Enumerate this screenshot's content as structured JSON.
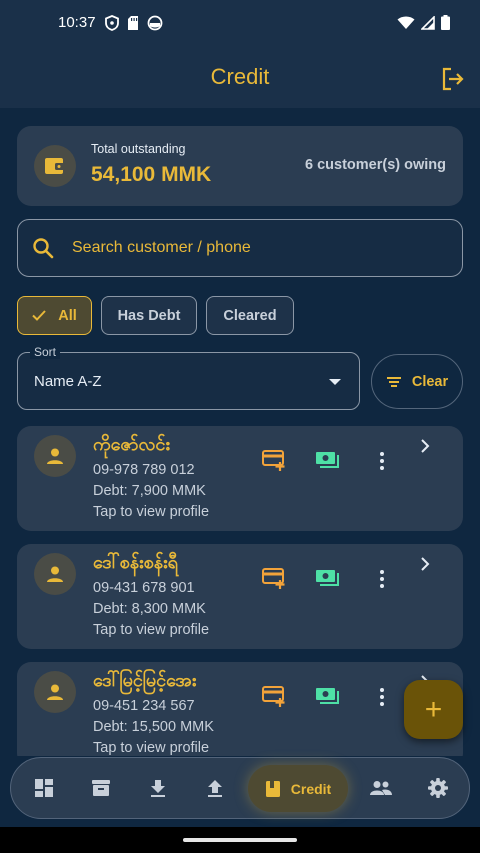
{
  "status_bar": {
    "time": "10:37"
  },
  "app_bar": {
    "title": "Credit"
  },
  "summary": {
    "label": "Total outstanding",
    "amount": "54,100 MMK",
    "owing": "6 customer(s) owing"
  },
  "search": {
    "placeholder": "Search customer / phone"
  },
  "filters": [
    {
      "label": "All",
      "selected": true
    },
    {
      "label": "Has Debt",
      "selected": false
    },
    {
      "label": "Cleared",
      "selected": false
    }
  ],
  "sort": {
    "label": "Sort",
    "value": "Name A-Z"
  },
  "clear_button": {
    "label": "Clear"
  },
  "customers": [
    {
      "name": "ကိုဇော်လင်း",
      "phone": "09-978 789 012",
      "debt": "Debt: 7,900 MMK",
      "hint": "Tap to view profile"
    },
    {
      "name": "ဒေါ်စန်းစန်းရီ",
      "phone": "09-431 678 901",
      "debt": "Debt: 8,300 MMK",
      "hint": "Tap to view profile"
    },
    {
      "name": "ဒေါ်မြင့်မြင့်အေး",
      "phone": "09-451 234 567",
      "debt": "Debt: 15,500 MMK",
      "hint": "Tap to view profile"
    }
  ],
  "fab": {
    "icon": "+"
  },
  "bottom_nav": {
    "items": [
      "dashboard-icon",
      "archive-icon",
      "download-icon",
      "upload-icon",
      "book-icon",
      "people-icon",
      "gear-icon"
    ],
    "active_label": "Credit"
  },
  "colors": {
    "background": "#0f2740",
    "surface": "#2b3d52",
    "accent": "#e9b939",
    "action_orange": "#f2a33a",
    "action_green": "#4ee0a6"
  }
}
